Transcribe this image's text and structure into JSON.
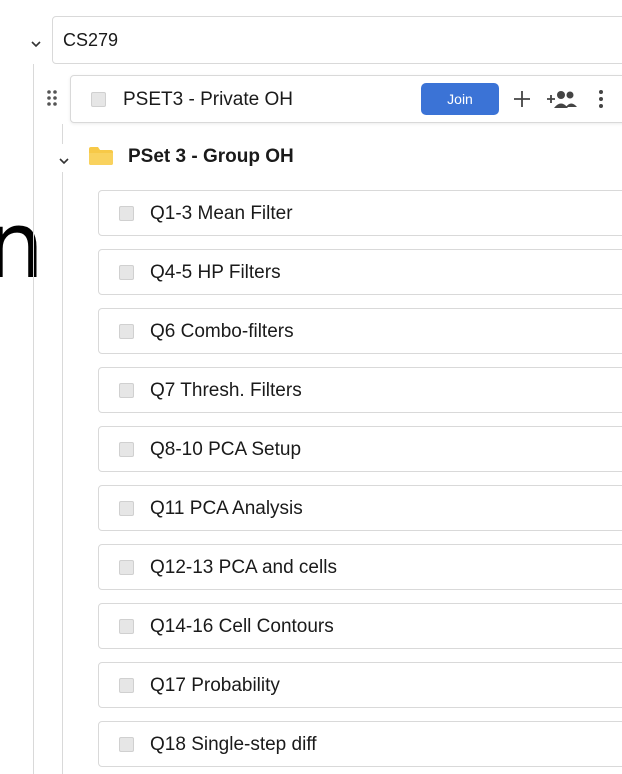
{
  "course": {
    "name": "CS279"
  },
  "private_oh": {
    "title": "PSET3 - Private OH",
    "join_label": "Join"
  },
  "group": {
    "title": "PSet 3 - Group OH"
  },
  "questions": [
    {
      "label": "Q1-3 Mean Filter"
    },
    {
      "label": "Q4-5 HP Filters"
    },
    {
      "label": "Q6 Combo-filters"
    },
    {
      "label": "Q7 Thresh. Filters"
    },
    {
      "label": "Q8-10 PCA Setup"
    },
    {
      "label": "Q11 PCA Analysis"
    },
    {
      "label": "Q12-13 PCA and cells"
    },
    {
      "label": "Q14-16 Cell Contours"
    },
    {
      "label": "Q17 Probability"
    },
    {
      "label": "Q18 Single-step diff"
    }
  ],
  "colors": {
    "accent": "#3b73d6",
    "folder": "#f7c948",
    "border": "#d9d9d9",
    "checkbox": "#e6e6e6"
  },
  "icons": {
    "course_toggle": "chevron-down-icon",
    "drag": "drag-handle-icon",
    "add": "plus-icon",
    "add_user": "add-user-icon",
    "more": "more-vertical-icon",
    "folder": "folder-icon",
    "group_toggle": "chevron-down-icon"
  }
}
